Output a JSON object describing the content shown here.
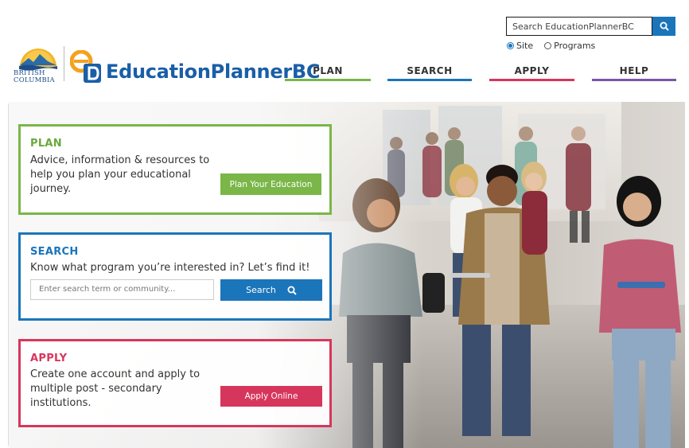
{
  "header": {
    "search_value": "Search EducationPlannerBC",
    "radio_site": "Site",
    "radio_programs": "Programs",
    "bc_logo_line1": "BRITISH",
    "bc_logo_line2": "COLUMBIA",
    "brand": "EducationPlannerBC"
  },
  "nav": {
    "plan": "PLAN",
    "search": "SEARCH",
    "apply": "APPLY",
    "help": "HELP"
  },
  "plan_card": {
    "title": "PLAN",
    "desc": "Advice, information & resources to help you plan your educational journey.",
    "button": "Plan Your Education"
  },
  "search_card": {
    "title": "SEARCH",
    "desc": "Know what program you’re interested in? Let’s find it!",
    "placeholder": "Enter search term or community...",
    "button": "Search"
  },
  "apply_card": {
    "title": "APPLY",
    "desc": "Create one account and apply to multiple post - secondary institutions.",
    "button": "Apply Online"
  },
  "colors": {
    "plan": "#7ab648",
    "search": "#1b75bb",
    "apply": "#d7365c",
    "help": "#7a56a8"
  },
  "icons": [
    "search-icon",
    "bc-logo",
    "educationplanner-logo-mark"
  ]
}
